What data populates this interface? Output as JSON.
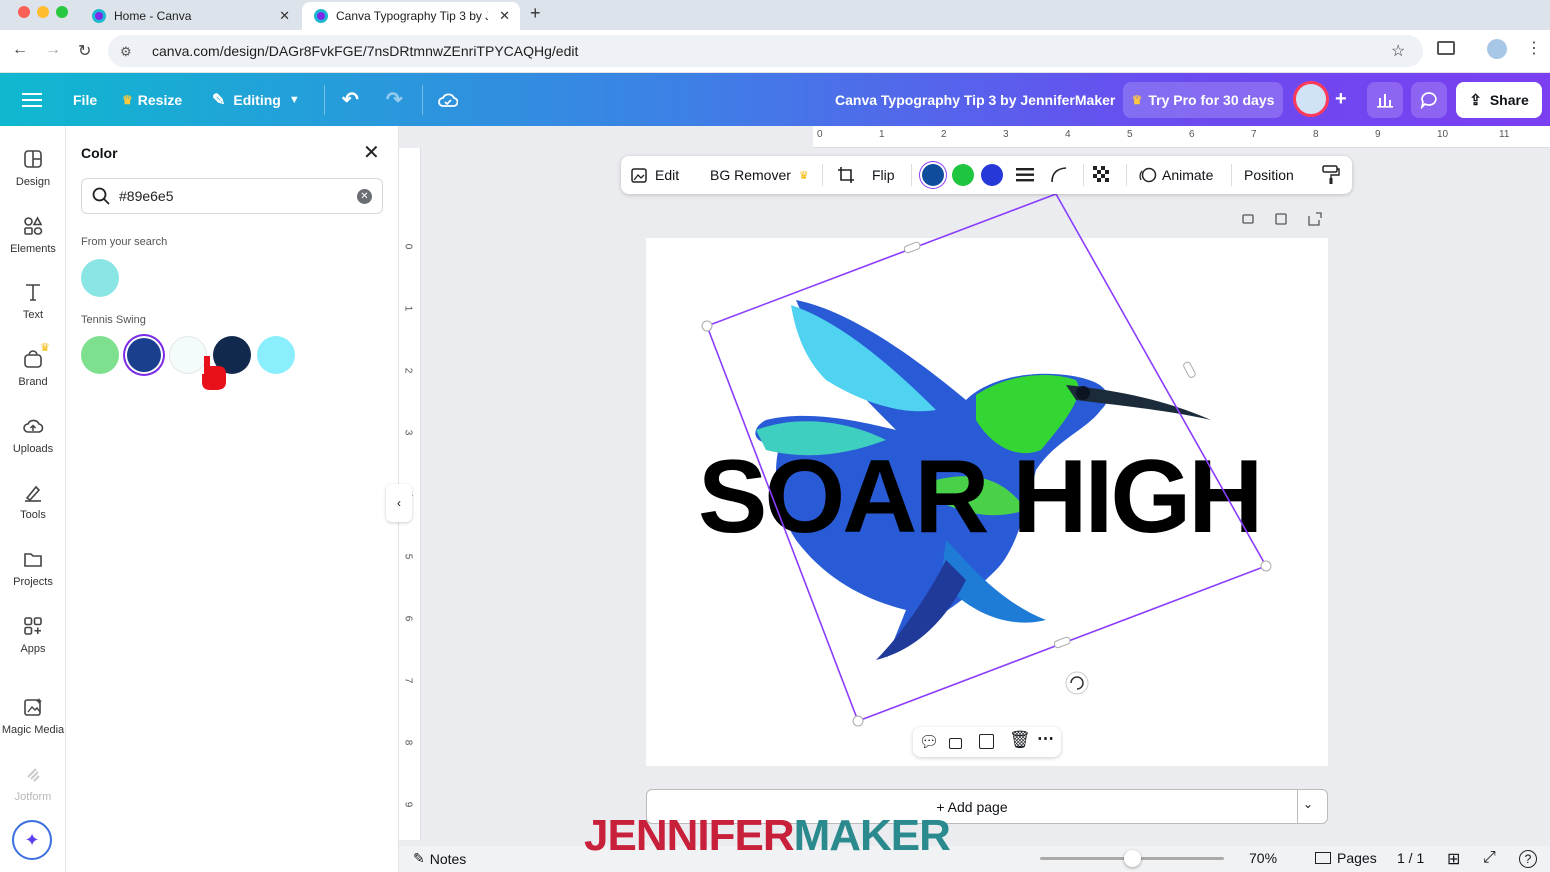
{
  "browser": {
    "tabs": [
      {
        "title": "Home - Canva",
        "active": false
      },
      {
        "title": "Canva Typography Tip 3 by J",
        "active": true
      }
    ],
    "new_tab": "+",
    "url": "canva.com/design/DAGr8FvkFGE/7nsDRtmnwZEnriTPYCAQHg/edit"
  },
  "header": {
    "file": "File",
    "resize": "Resize",
    "editing": "Editing",
    "title": "Canva Typography Tip 3 by JenniferMaker",
    "try_pro": "Try Pro for 30 days",
    "share": "Share"
  },
  "rail": {
    "items": [
      {
        "label": "Design",
        "icon": "design-icon"
      },
      {
        "label": "Elements",
        "icon": "elements-icon"
      },
      {
        "label": "Text",
        "icon": "text-icon"
      },
      {
        "label": "Brand",
        "icon": "brand-icon"
      },
      {
        "label": "Uploads",
        "icon": "uploads-icon"
      },
      {
        "label": "Tools",
        "icon": "tools-icon"
      },
      {
        "label": "Projects",
        "icon": "projects-icon"
      },
      {
        "label": "Apps",
        "icon": "apps-icon"
      },
      {
        "label": "Magic Media",
        "icon": "magic-media-icon"
      },
      {
        "label": "Jotform",
        "icon": "jotform-icon"
      }
    ]
  },
  "panel": {
    "title": "Color",
    "search_value": "#89e6e5",
    "section_search": "From your search",
    "search_colors": [
      "#89e6e5"
    ],
    "section_palette": "Tennis Swing",
    "palette_colors": [
      "#7ee08f",
      "#1a3f8f",
      "#f4fbfb",
      "#10294d",
      "#8aeefc"
    ]
  },
  "context_toolbar": {
    "edit": "Edit",
    "bg_remover": "BG Remover",
    "flip": "Flip",
    "swatches": [
      "#0f4c9b",
      "#1ec63f",
      "#2738d8"
    ],
    "animate": "Animate",
    "position": "Position"
  },
  "rulers": {
    "top": [
      "0",
      "1",
      "2",
      "3",
      "4",
      "5",
      "6",
      "7",
      "8",
      "9",
      "10",
      "11"
    ],
    "left": [
      "0",
      "1",
      "2",
      "3",
      "4",
      "5",
      "6",
      "7",
      "8",
      "9"
    ]
  },
  "canvas": {
    "headline": "SOAR HIGH",
    "add_page": "+ Add page"
  },
  "footer": {
    "notes": "Notes",
    "zoom": "70%",
    "zoom_level": 0.7,
    "pages": "Pages",
    "page_count": "1 / 1"
  },
  "watermark": {
    "part1": "JENNIFER",
    "part2": "MAKER",
    "color1": "#c8203a",
    "color2": "#2a8a8e"
  },
  "colors": {
    "selection": "#8b3dff",
    "accent": "#7d2ae8"
  }
}
